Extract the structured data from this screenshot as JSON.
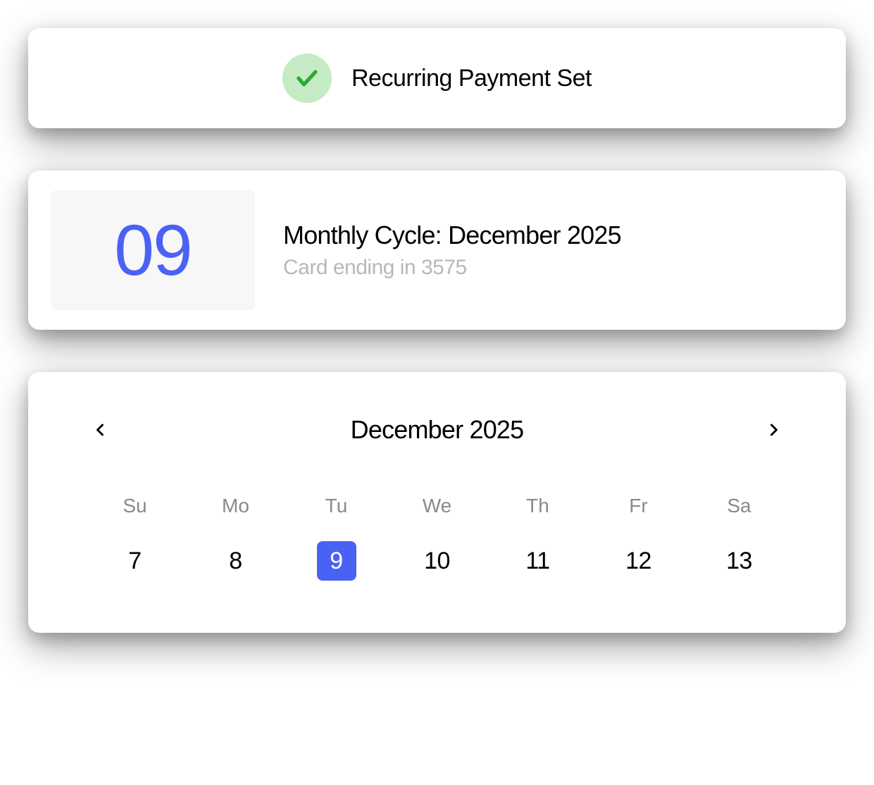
{
  "status": {
    "label": "Recurring Payment Set"
  },
  "cycle": {
    "day": "09",
    "title": "Monthly Cycle: December 2025",
    "subtitle": "Card ending in 3575"
  },
  "calendar": {
    "month_label": "December 2025",
    "weekdays": [
      "Su",
      "Mo",
      "Tu",
      "We",
      "Th",
      "Fr",
      "Sa"
    ],
    "days": [
      {
        "num": "7",
        "selected": false
      },
      {
        "num": "8",
        "selected": false
      },
      {
        "num": "9",
        "selected": true
      },
      {
        "num": "10",
        "selected": false
      },
      {
        "num": "11",
        "selected": false
      },
      {
        "num": "12",
        "selected": false
      },
      {
        "num": "13",
        "selected": false
      }
    ]
  }
}
